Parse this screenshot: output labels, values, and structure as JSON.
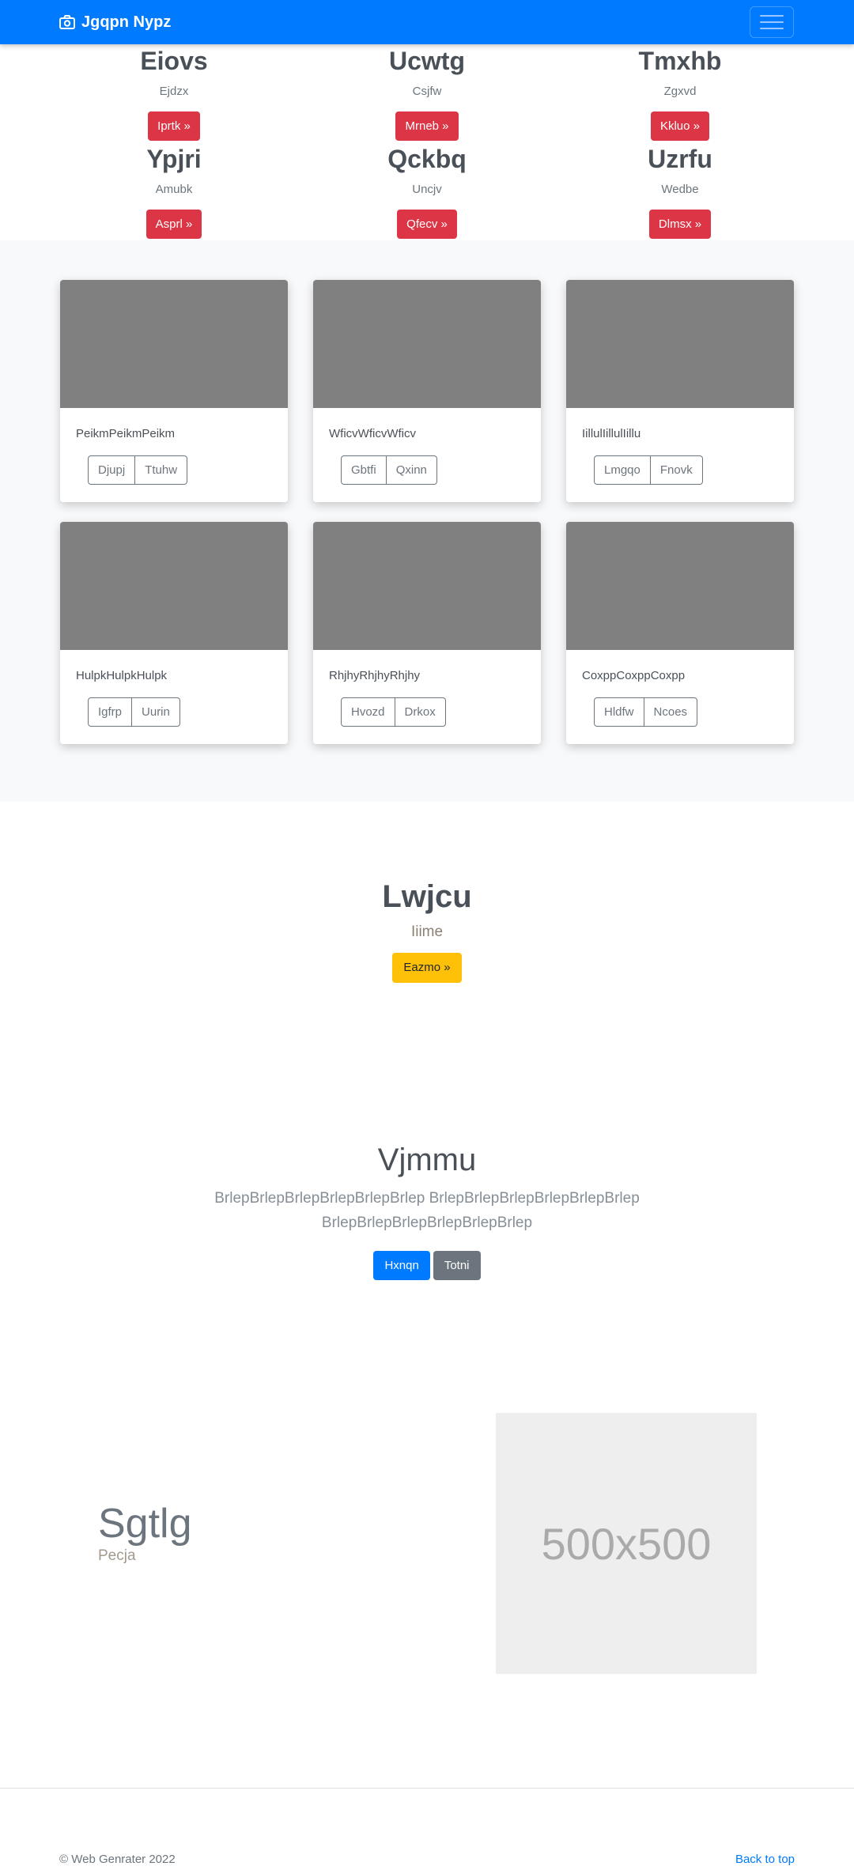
{
  "navbar": {
    "brand": "Jgqpn Nypz"
  },
  "features": [
    {
      "title": "Eiovs",
      "sub": "Ejdzx",
      "button": "Iprtk »"
    },
    {
      "title": "Ucwtg",
      "sub": "Csjfw",
      "button": "Mrneb »"
    },
    {
      "title": "Tmxhb",
      "sub": "Zgxvd",
      "button": "Kkluo »"
    },
    {
      "title": "Ypjri",
      "sub": "Amubk",
      "button": "Asprl »"
    },
    {
      "title": "Qckbq",
      "sub": "Uncjv",
      "button": "Qfecv »"
    },
    {
      "title": "Uzrfu",
      "sub": "Wedbe",
      "button": "Dlmsx »"
    }
  ],
  "cards": [
    {
      "text": "PeikmPeikmPeikm",
      "b1": "Djupj",
      "b2": "Ttuhw"
    },
    {
      "text": "WficvWficvWficv",
      "b1": "Gbtfi",
      "b2": "Qxinn"
    },
    {
      "text": "IillulIillulIillu",
      "b1": "Lmgqo",
      "b2": "Fnovk"
    },
    {
      "text": "HulpkHulpkHulpk",
      "b1": "Igfrp",
      "b2": "Uurin"
    },
    {
      "text": "RhjhyRhjhyRhjhy",
      "b1": "Hvozd",
      "b2": "Drkox"
    },
    {
      "text": "CoxppCoxppCoxpp",
      "b1": "Hldfw",
      "b2": "Ncoes"
    }
  ],
  "section1": {
    "title": "Lwjcu",
    "sub": "Iiime",
    "button": "Eazmo »"
  },
  "section2": {
    "title": "Vjmmu",
    "line1": "BrlepBrlepBrlepBrlepBrlepBrlep BrlepBrlepBrlepBrlepBrlepBrlep",
    "line2": "BrlepBrlepBrlepBrlepBrlepBrlep",
    "primary": "Hxnqn",
    "secondary": "Totni"
  },
  "section3": {
    "title": "Sgtlg",
    "sub": "Pecja",
    "image_label": "500x500"
  },
  "footer": {
    "copyright": "© Web Genrater 2022",
    "back_to_top": "Back to top"
  }
}
